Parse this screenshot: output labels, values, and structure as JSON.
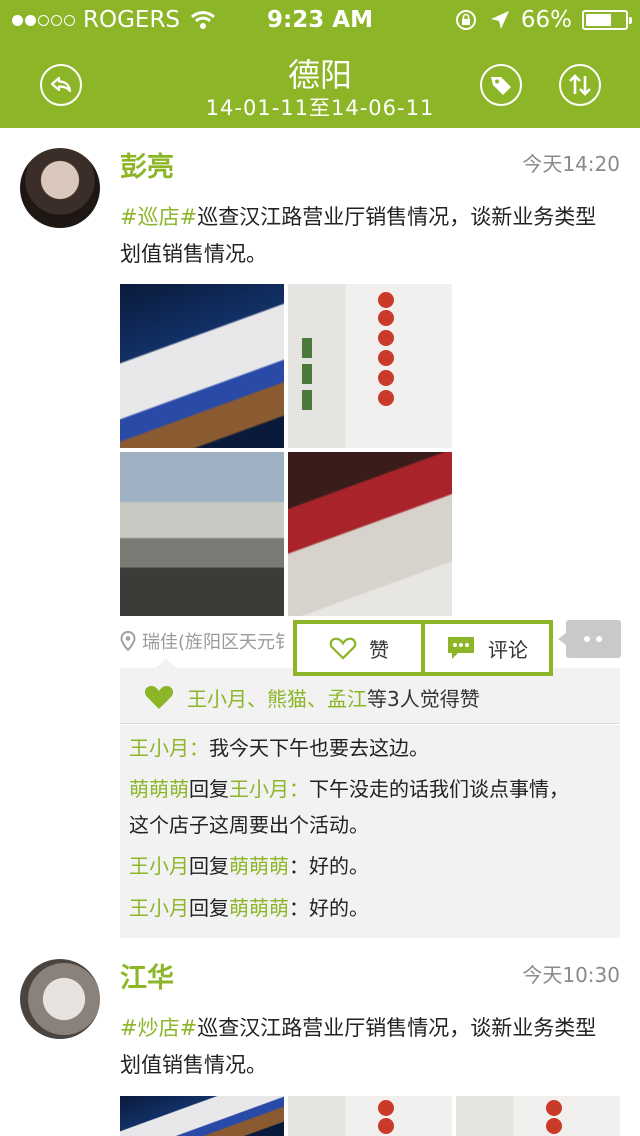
{
  "status_bar": {
    "carrier": "ROGERS",
    "time": "9:23 AM",
    "battery": "66%",
    "battery_level": 0.66,
    "signal_bars_filled": 2,
    "signal_bars_total": 5
  },
  "nav": {
    "title": "德阳",
    "subtitle": "14-01-11至14-06-11",
    "icons": [
      "back-icon",
      "tag-icon",
      "sort-icon"
    ]
  },
  "posts": [
    {
      "author": "彭亮",
      "time": "今天14:20",
      "tag": "#巡店#",
      "text_line1": "巡查汉江路营业厅销售情况，谈新业务类型",
      "text_line2": "划值销售情况。",
      "location": "瑞佳(旌阳区天元钅",
      "likes": {
        "names": "王小月、熊猫、孟江",
        "suffix": "等3人觉得赞"
      },
      "comments": [
        {
          "from": "王小月：",
          "text": "我今天下午也要去这边。"
        },
        {
          "from": "萌萌萌",
          "reply": "回复",
          "to": "王小月：",
          "text": "下午没走的话我们谈点事情，",
          "text2": "这个店子这周要出个活动。"
        },
        {
          "from": "王小月",
          "reply": "回复",
          "to": "萌萌萌",
          "text": "：好的。"
        },
        {
          "from": "王小月",
          "reply": "回复",
          "to": "萌萌萌",
          "text": "：好的。"
        }
      ]
    },
    {
      "author": "江华",
      "time": "今天10:30",
      "tag": "#炒店#",
      "text_line1": "巡查汉江路营业厅销售情况，谈新业务类型",
      "text_line2": "划值销售情况。"
    }
  ],
  "actions": {
    "like_label": "赞",
    "comment_label": "评论"
  },
  "colors": {
    "brand": "#8cb628",
    "comment_bg": "#f2f2f2",
    "meta_gray": "#8a8a8a"
  }
}
